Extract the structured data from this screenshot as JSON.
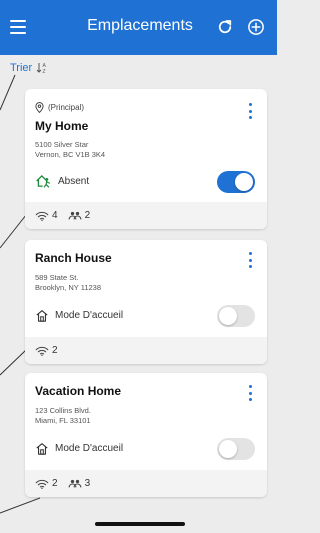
{
  "header": {
    "title": "Emplacements",
    "bg_color": "#1f72d3"
  },
  "sort": {
    "label": "Trier"
  },
  "locations": [
    {
      "badge": "(Principal)",
      "name": "My Home",
      "address_line1": "5100 Silver Star",
      "address_line2": "Vernon, BC V1B 3K4",
      "mode": "Absent",
      "mode_icon": "away-person-icon",
      "toggle_on": true,
      "wifi_count": "4",
      "users_count": "2"
    },
    {
      "name": "Ranch House",
      "address_line1": "589 State St.",
      "address_line2": "Brooklyn, NY 11238",
      "mode": "Mode D'accueil",
      "mode_icon": "home-icon",
      "toggle_on": false,
      "wifi_count": "2"
    },
    {
      "name": "Vacation Home",
      "address_line1": "123 Collins Blvd.",
      "address_line2": "Miami, FL 33101",
      "mode": "Mode D'accueil",
      "mode_icon": "home-icon",
      "toggle_on": false,
      "wifi_count": "2",
      "users_count": "3"
    }
  ]
}
